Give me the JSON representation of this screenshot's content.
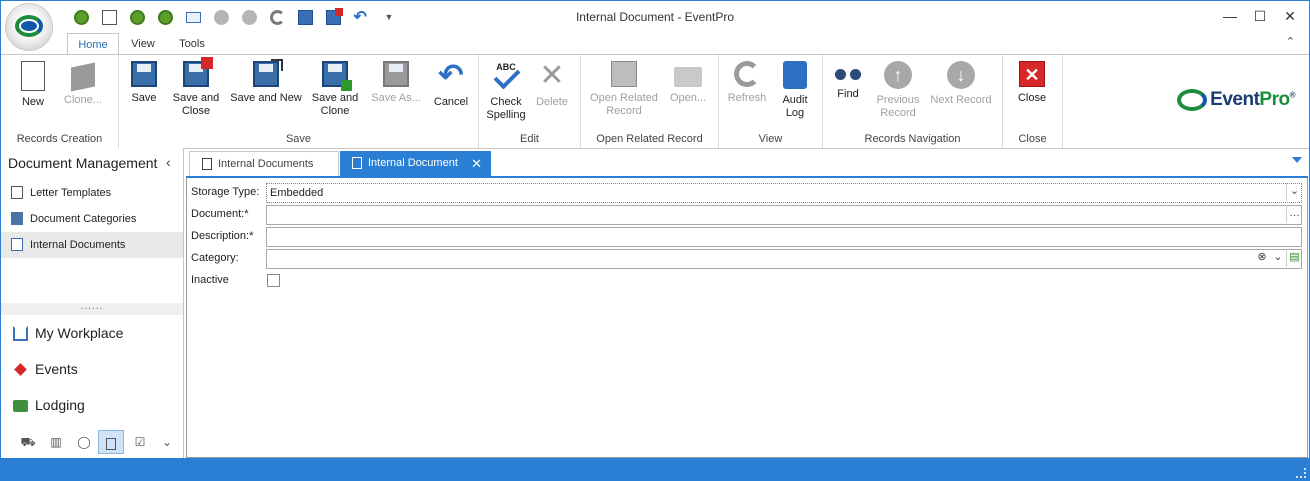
{
  "window": {
    "title": "Internal Document - EventPro"
  },
  "ribbon_tabs": [
    "Home",
    "View",
    "Tools"
  ],
  "ribbon": {
    "groups": {
      "records_creation": "Records Creation",
      "save": "Save",
      "edit": "Edit",
      "open_related": "Open Related Record",
      "view": "View",
      "records_navigation": "Records Navigation",
      "close": "Close"
    },
    "buttons": {
      "new": "New",
      "clone": "Clone...",
      "save": "Save",
      "save_and_close_1": "Save and",
      "save_and_close_2": "Close",
      "save_and_new": "Save and New",
      "save_and_clone_1": "Save and",
      "save_and_clone_2": "Clone",
      "save_as": "Save As...",
      "cancel": "Cancel",
      "check_spelling_1": "Check",
      "check_spelling_2": "Spelling",
      "delete": "Delete",
      "open_related_1": "Open Related",
      "open_related_2": "Record",
      "open": "Open...",
      "refresh": "Refresh",
      "audit_log_1": "Audit",
      "audit_log_2": "Log",
      "find": "Find",
      "previous_record_1": "Previous",
      "previous_record_2": "Record",
      "next_record": "Next Record",
      "close": "Close"
    },
    "abc_label": "ABC"
  },
  "brand": {
    "name": "Event",
    "name_pro": "Pro",
    "reg": "®"
  },
  "left_panel": {
    "title": "Document Management",
    "items": [
      {
        "label": "Letter Templates",
        "icon": "letter-template-icon"
      },
      {
        "label": "Document Categories",
        "icon": "document-categories-icon"
      },
      {
        "label": "Internal Documents",
        "icon": "internal-document-icon",
        "selected": true
      }
    ],
    "splitter": "......",
    "nav": [
      {
        "label": "My Workplace",
        "icon": "house-icon"
      },
      {
        "label": "Events",
        "icon": "pin-icon"
      },
      {
        "label": "Lodging",
        "icon": "lodging-icon"
      }
    ]
  },
  "doc_tabs": [
    {
      "label": "Internal Documents",
      "active": false
    },
    {
      "label": "Internal Document",
      "active": true
    }
  ],
  "form": {
    "storage_type": {
      "label": "Storage Type:",
      "value": "Embedded"
    },
    "document": {
      "label": "Document:*",
      "value": ""
    },
    "description": {
      "label": "Description:*",
      "value": ""
    },
    "category": {
      "label": "Category:",
      "value": ""
    },
    "inactive": {
      "label": "Inactive",
      "checked": false
    }
  },
  "colors": {
    "accent": "#2a7fd4",
    "disabled": "#a0a0a0",
    "close_red": "#d62828"
  }
}
